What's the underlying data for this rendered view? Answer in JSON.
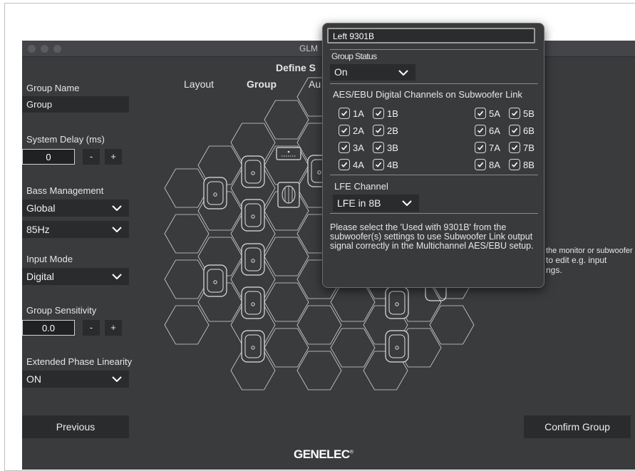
{
  "window": {
    "title": "GLM"
  },
  "header": {
    "title": "Define S",
    "tabs": [
      "Layout",
      "Group",
      "Au"
    ]
  },
  "left_panel": {
    "group_name_label": "Group Name",
    "group_name_value": "Group",
    "system_delay_label": "System Delay (ms)",
    "system_delay_value": "0",
    "minus": "-",
    "plus": "+",
    "bass_management_label": "Bass Management",
    "bass_management_value": "Global",
    "crossover_value": "85Hz",
    "input_mode_label": "Input Mode",
    "input_mode_value": "Digital",
    "group_sensitivity_label": "Group Sensitivity",
    "group_sensitivity_value": "0.0",
    "extended_phase_label": "Extended Phase Linearity",
    "extended_phase_value": "ON"
  },
  "buttons": {
    "previous": "Previous",
    "confirm": "Confirm Group"
  },
  "hint": {
    "line1": "the monitor or subwoofer",
    "line2": "to edit e.g. input",
    "line3": "ngs."
  },
  "logo": {
    "text": "GENELEC",
    "mark": "®"
  },
  "popup": {
    "device_name": "Left 9301B",
    "group_status_label": "Group Status",
    "group_status_value": "On",
    "aes_label": "AES/EBU Digital Channels on Subwoofer Link",
    "channels": [
      "1A",
      "1B",
      "2A",
      "2B",
      "3A",
      "3B",
      "4A",
      "4B",
      "5A",
      "5B",
      "6A",
      "6B",
      "7A",
      "7B",
      "8A",
      "8B"
    ],
    "lfe_label": "LFE Channel",
    "lfe_value": "LFE in 8B",
    "note": "Please select the 'Used with 9301B' from the subwoofer(s) settings to use Subwoofer Link output signal correctly in the Multichannel AES/EBU setup."
  }
}
